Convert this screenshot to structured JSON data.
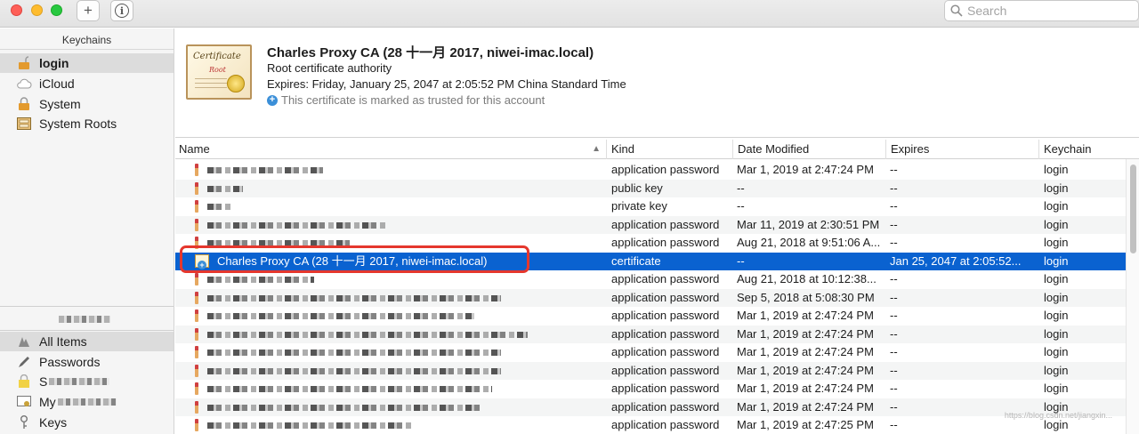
{
  "toolbar": {
    "add_label": "+",
    "info_label": "i",
    "search_placeholder": "Search"
  },
  "sidebar": {
    "keychains_header": "Keychains",
    "keychains": [
      {
        "label": "login",
        "icon": "lock-open-icon",
        "selected": true
      },
      {
        "label": "iCloud",
        "icon": "cloud-icon",
        "selected": false
      },
      {
        "label": "System",
        "icon": "lock-icon",
        "selected": false
      },
      {
        "label": "System Roots",
        "icon": "cabinet-icon",
        "selected": false
      }
    ],
    "categories": [
      {
        "label": "All Items",
        "icon": "all-items-icon",
        "selected": true
      },
      {
        "label": "Passwords",
        "icon": "pen-icon"
      },
      {
        "label": "S",
        "icon": "lock-note-icon"
      },
      {
        "label": "My",
        "icon": "certificate-icon"
      },
      {
        "label": "Keys",
        "icon": "key-icon"
      }
    ]
  },
  "detail": {
    "title": "Charles Proxy CA (28 十一月 2017, niwei-imac.local)",
    "subtitle": "Root certificate authority",
    "expires": "Expires: Friday, January 25, 2047 at 2:05:52 PM China Standard Time",
    "trust": "This certificate is marked as trusted for this account",
    "cert_word": "Certificate",
    "cert_word2": "Root"
  },
  "table": {
    "columns": [
      "Name",
      "Kind",
      "Date Modified",
      "Expires",
      "Keychain"
    ],
    "rows": [
      {
        "kind": "application password",
        "date": "Mar 1, 2019 at 2:47:24 PM",
        "expires": "--",
        "keychain": "login"
      },
      {
        "kind": "public key",
        "date": "--",
        "expires": "--",
        "keychain": "login"
      },
      {
        "kind": "private key",
        "date": "--",
        "expires": "--",
        "keychain": "login"
      },
      {
        "kind": "application password",
        "date": "Mar 11, 2019 at 2:30:51 PM",
        "expires": "--",
        "keychain": "login"
      },
      {
        "kind": "application password",
        "date": "Aug 21, 2018 at 9:51:06 A...",
        "expires": "--",
        "keychain": "login"
      },
      {
        "name": "Charles Proxy CA (28 十一月 2017, niwei-imac.local)",
        "kind": "certificate",
        "date": "--",
        "expires": "Jan 25, 2047 at 2:05:52...",
        "keychain": "login",
        "selected": true
      },
      {
        "kind": "application password",
        "date": "Aug 21, 2018 at 10:12:38...",
        "expires": "--",
        "keychain": "login"
      },
      {
        "kind": "application password",
        "date": "Sep 5, 2018 at 5:08:30 PM",
        "expires": "--",
        "keychain": "login"
      },
      {
        "kind": "application password",
        "date": "Mar 1, 2019 at 2:47:24 PM",
        "expires": "--",
        "keychain": "login"
      },
      {
        "kind": "application password",
        "date": "Mar 1, 2019 at 2:47:24 PM",
        "expires": "--",
        "keychain": "login"
      },
      {
        "kind": "application password",
        "date": "Mar 1, 2019 at 2:47:24 PM",
        "expires": "--",
        "keychain": "login"
      },
      {
        "kind": "application password",
        "date": "Mar 1, 2019 at 2:47:24 PM",
        "expires": "--",
        "keychain": "login"
      },
      {
        "kind": "application password",
        "date": "Mar 1, 2019 at 2:47:24 PM",
        "expires": "--",
        "keychain": "login"
      },
      {
        "kind": "application password",
        "date": "Mar 1, 2019 at 2:47:24 PM",
        "expires": "--",
        "keychain": "login"
      },
      {
        "kind": "application password",
        "date": "Mar 1, 2019 at 2:47:25 PM",
        "expires": "--",
        "keychain": "login"
      }
    ]
  },
  "watermark": "https://blog.csdn.net/jiangxin..."
}
